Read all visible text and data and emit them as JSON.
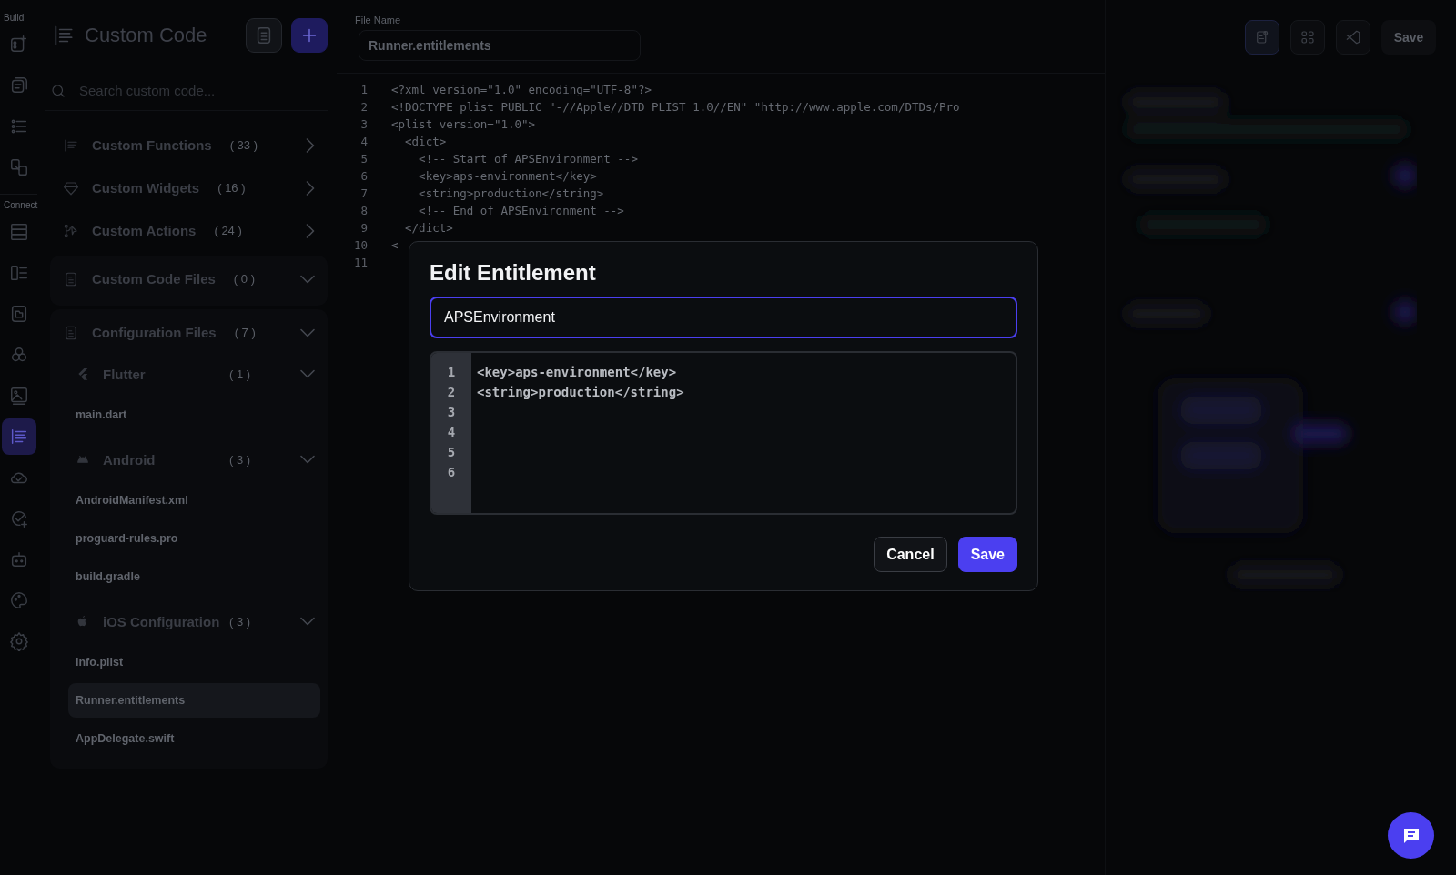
{
  "rail": {
    "sections": [
      {
        "label": "Build",
        "items": [
          {
            "selected": false
          },
          {
            "selected": false
          },
          {
            "selected": false
          },
          {
            "selected": false
          }
        ]
      },
      {
        "label": "Connect",
        "items": [
          {
            "selected": false
          },
          {
            "selected": false
          },
          {
            "selected": false
          },
          {
            "selected": false
          },
          {
            "selected": false
          },
          {
            "selected": true
          },
          {
            "selected": false
          },
          {
            "selected": false
          },
          {
            "selected": false
          },
          {
            "selected": false
          },
          {
            "selected": false
          }
        ]
      }
    ]
  },
  "panel": {
    "title": "Custom Code",
    "search": {
      "placeholder": "Search custom code..."
    },
    "categories": [
      {
        "label": "Custom Functions",
        "count": "( 33 )",
        "expanded": false
      },
      {
        "label": "Custom Widgets",
        "count": "( 16 )",
        "expanded": false
      },
      {
        "label": "Custom Actions",
        "count": "( 24 )",
        "expanded": false
      },
      {
        "label": "Custom Code Files",
        "count": "( 0 )",
        "expanded": true
      }
    ],
    "config": {
      "label": "Configuration Files",
      "count": "( 7 )",
      "expanded": true,
      "groups": [
        {
          "label": "Flutter",
          "count": "( 1 )",
          "expanded": true,
          "files": [
            {
              "name": "main.dart",
              "selected": false
            }
          ]
        },
        {
          "label": "Android",
          "count": "( 3 )",
          "expanded": true,
          "files": [
            {
              "name": "AndroidManifest.xml",
              "selected": false
            },
            {
              "name": "proguard-rules.pro",
              "selected": false
            },
            {
              "name": "build.gradle",
              "selected": false
            }
          ]
        },
        {
          "label": "iOS Configuration",
          "count": "( 3 )",
          "expanded": true,
          "files": [
            {
              "name": "Info.plist",
              "selected": false
            },
            {
              "name": "Runner.entitlements",
              "selected": true
            },
            {
              "name": "AppDelegate.swift",
              "selected": false
            }
          ]
        }
      ]
    }
  },
  "editor": {
    "file_name_label": "File Name",
    "file_name": "Runner.entitlements",
    "lines": [
      {
        "number": "1",
        "text": "<?xml version=\"1.0\" encoding=\"UTF-8\"?>"
      },
      {
        "number": "2",
        "text": "<!DOCTYPE plist PUBLIC \"-//Apple//DTD PLIST 1.0//EN\" \"http://www.apple.com/DTDs/Pro"
      },
      {
        "number": "3",
        "text": "<plist version=\"1.0\">"
      },
      {
        "number": "4",
        "text": "  <dict>"
      },
      {
        "number": "5",
        "text": "    <!-- Start of APSEnvironment -->"
      },
      {
        "number": "6",
        "text": "    <key>aps-environment</key>"
      },
      {
        "number": "7",
        "text": "    <string>production</string>"
      },
      {
        "number": "8",
        "text": "    <!-- End of APSEnvironment -->"
      },
      {
        "number": "9",
        "text": "  </dict>"
      },
      {
        "number": "10",
        "text": "<"
      },
      {
        "number": "11"
      }
    ]
  },
  "toolbar": {
    "save": {
      "label": "Save",
      "disabled": true
    }
  },
  "dialog": {
    "title": "Edit Entitlement",
    "name_value": "APSEnvironment",
    "lines": [
      {
        "number": "1",
        "text": "<key>aps-environment</key>"
      },
      {
        "number": "2",
        "text": "<string>production</string>"
      },
      {
        "number": "3"
      },
      {
        "number": "4"
      },
      {
        "number": "5"
      },
      {
        "number": "6"
      }
    ],
    "buttons": [
      {
        "label": "Cancel",
        "kind": "secondary"
      },
      {
        "label": "Save",
        "kind": "primary"
      }
    ]
  }
}
